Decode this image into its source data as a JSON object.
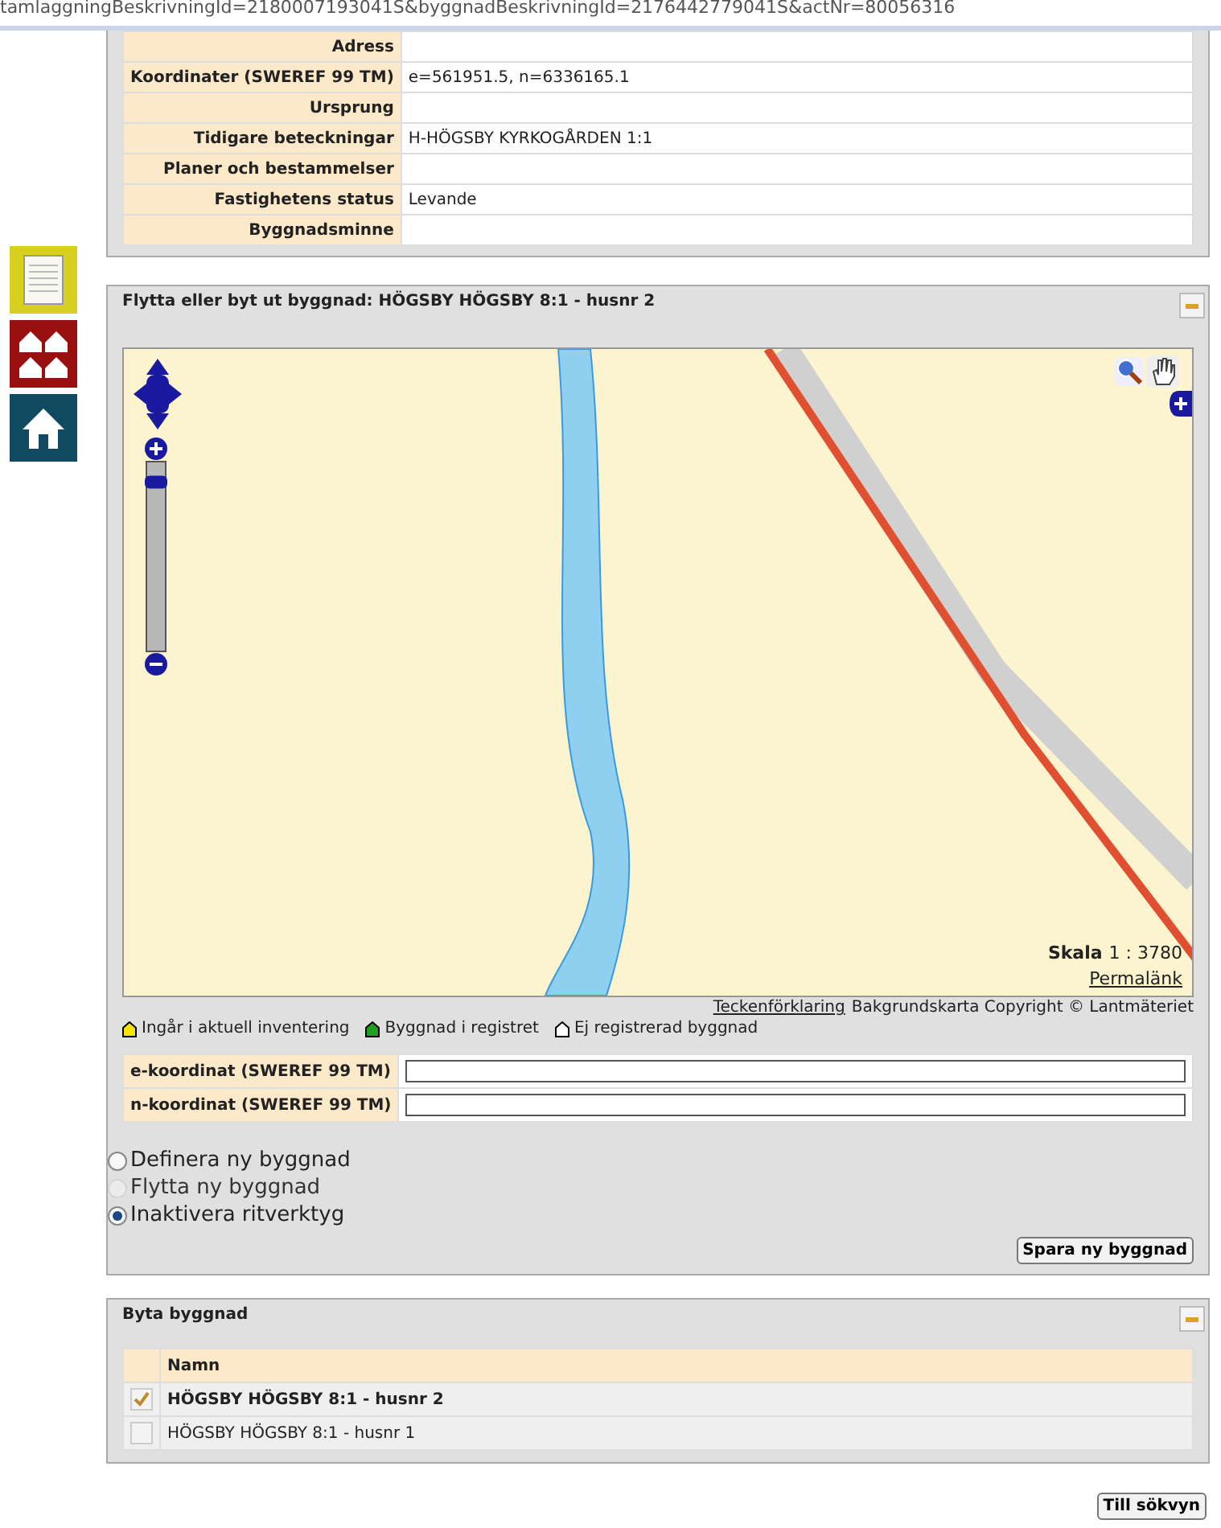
{
  "address_bar": {
    "url": "tamlaggningBeskrivningId=2180007193041S&byggnadBeskrivningId=2176442779041S&actNr=80056316"
  },
  "side_icons": [
    {
      "kind": "document"
    },
    {
      "kind": "houses"
    },
    {
      "kind": "home"
    }
  ],
  "info_table": {
    "rows": [
      {
        "label": "Adress"
      },
      {
        "label": "Koordinater (SWEREF 99 TM)",
        "value": "e=561951.5, n=6336165.1"
      },
      {
        "label": "Ursprung"
      },
      {
        "label": "Tidigare beteckningar",
        "value": "H-HÖGSBY KYRKOGÅRDEN 1:1"
      },
      {
        "label": "Planer och bestammelser"
      },
      {
        "label": "Fastighetens status",
        "value": "Levande"
      },
      {
        "label": "Byggnadsminne"
      }
    ]
  },
  "move_panel": {
    "title": "Flytta eller byt ut byggnad: HÖGSBY HÖGSBY 8:1 - husnr 2",
    "map": {
      "zoom": {
        "level": 0.92
      },
      "scale_label": "Skala",
      "scale_value": "1 : 3780",
      "permalink": "Permalänk"
    },
    "legend_link": "Teckenförklaring",
    "copyright": "Bakgrundskarta Copyright © Lantmäteriet",
    "legend": [
      {
        "label": "Ingår i aktuell inventering",
        "color": "#f2e600"
      },
      {
        "label": "Byggnad i registret",
        "color": "#1fa01f"
      },
      {
        "label": "Ej registrerad byggnad",
        "color": "#ffffff"
      }
    ],
    "coordinate_fields": [
      {
        "label": "e-koordinat (SWEREF 99 TM)"
      },
      {
        "label": "n-koordinat (SWEREF 99 TM)"
      }
    ],
    "tools": [
      {
        "label": "Definera ny byggnad",
        "selected": false,
        "disabled": false
      },
      {
        "label": "Flytta ny byggnad",
        "selected": false,
        "disabled": true
      },
      {
        "label": "Inaktivera ritverktyg",
        "selected": true,
        "disabled": false
      }
    ],
    "save_button": "Spara ny byggnad"
  },
  "swap_panel": {
    "title": "Byta byggnad",
    "column": "Namn",
    "rows": [
      {
        "name": "HÖGSBY HÖGSBY 8:1 - husnr 2",
        "selected": true
      },
      {
        "name": "HÖGSBY HÖGSBY 8:1 - husnr 1",
        "selected": false
      }
    ]
  },
  "back_button": "Till sökvyn"
}
